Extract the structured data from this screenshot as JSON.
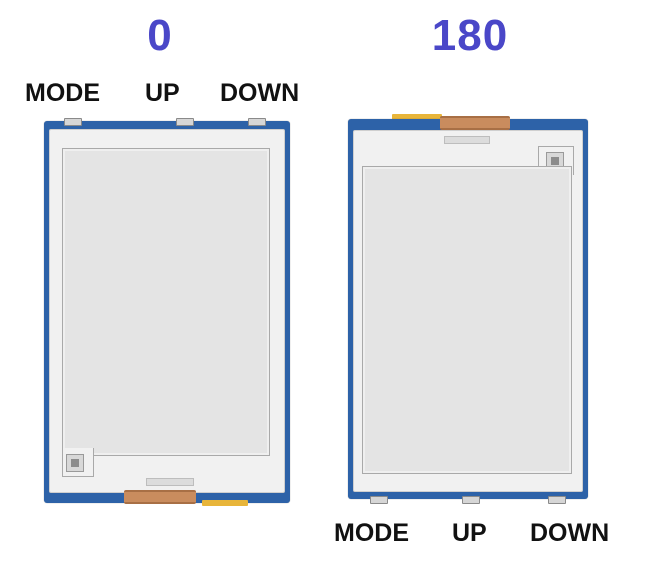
{
  "left_panel": {
    "rotation_label": "0",
    "buttons": [
      "MODE",
      "UP",
      "DOWN"
    ]
  },
  "right_panel": {
    "rotation_label": "180",
    "buttons": [
      "MODE",
      "UP",
      "DOWN"
    ]
  },
  "colors": {
    "label_blue": "#4a47c8",
    "pcb_blue": "#2d62a8",
    "fpc_copper": "#c98c5e",
    "tab_yellow": "#e8b53a"
  }
}
